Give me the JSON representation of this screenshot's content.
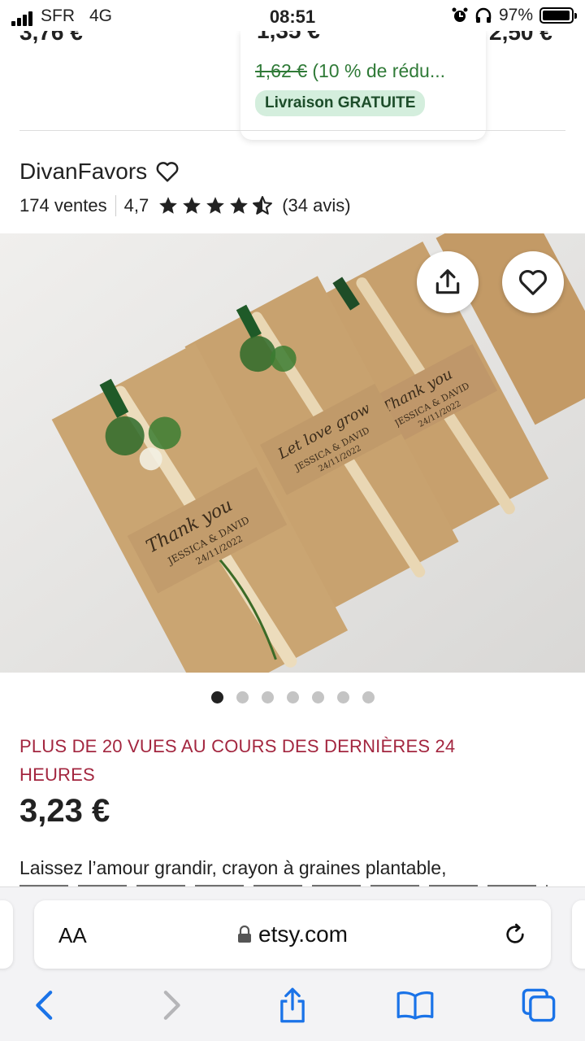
{
  "status_bar": {
    "carrier": "SFR",
    "network": "4G",
    "time": "08:51",
    "battery": "97%",
    "battery_level": 0.97
  },
  "previous_listing": {
    "prices": [
      "3,76 €",
      "1,35 €",
      "2,50 €"
    ],
    "original_price": "1,62 €",
    "discount": " (10 % de rédu...",
    "shipping_badge": "Livraison GRATUITE"
  },
  "shop": {
    "name": "DivanFavors",
    "sales": "174 ventes",
    "rating": "4,7",
    "rating_value": 4.7,
    "reviews": "(34 avis)"
  },
  "gallery": {
    "image_count": 7,
    "active_index": 0,
    "card_texts": [
      "Thank you",
      "Let love grow",
      "Thank you"
    ],
    "card_names": "JESSICA & DAVID",
    "card_date": "24/11/2022"
  },
  "listing": {
    "views_banner": "PLUS DE 20 VUES AU COURS DES DERNIÈRES 24 HEURES",
    "price": "3,23 €",
    "description": "Laissez l’amour grandir, crayon à graines plantable,"
  },
  "browser": {
    "text_size_label": "AA",
    "url": "etsy.com"
  },
  "colors": {
    "accent_red": "#a3263f",
    "green": "#2f7a37",
    "ios_blue": "#1a73e8"
  }
}
